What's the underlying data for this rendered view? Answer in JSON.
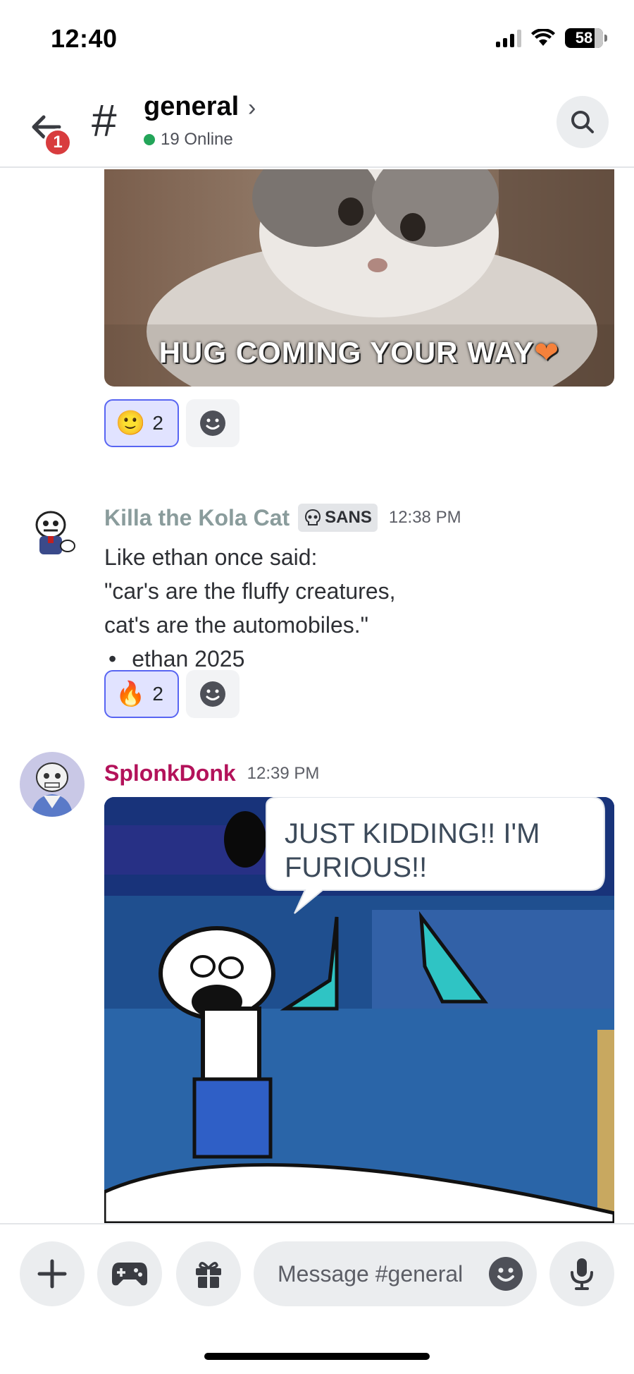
{
  "status_bar": {
    "time": "12:40",
    "battery": "58"
  },
  "header": {
    "back_badge": "1",
    "channel_name": "general",
    "online_text": "19 Online"
  },
  "messages": [
    {
      "gif_caption": "HUG COMING YOUR WAY",
      "reactions": [
        {
          "emoji": "🙂",
          "count": "2"
        }
      ]
    },
    {
      "author": "Killa the Kola Cat",
      "tag": "SANS",
      "timestamp": "12:38 PM",
      "lines": [
        "Like ethan once said:",
        "\"car's are the fluffy creatures,",
        "cat's are the automobiles.\""
      ],
      "bullet": "ethan 2025",
      "reactions": [
        {
          "emoji": "🔥",
          "count": "2"
        }
      ]
    },
    {
      "author": "SplonkDonk",
      "timestamp": "12:39 PM",
      "image_text": "JUST KIDDING!! I'M FURIOUS!!"
    }
  ],
  "composer": {
    "placeholder": "Message #general"
  },
  "colors": {
    "accent": "#5865f2",
    "online": "#23a559",
    "badge": "#d83c3e",
    "author1": "#8a9c9c",
    "author2": "#b3125a"
  }
}
